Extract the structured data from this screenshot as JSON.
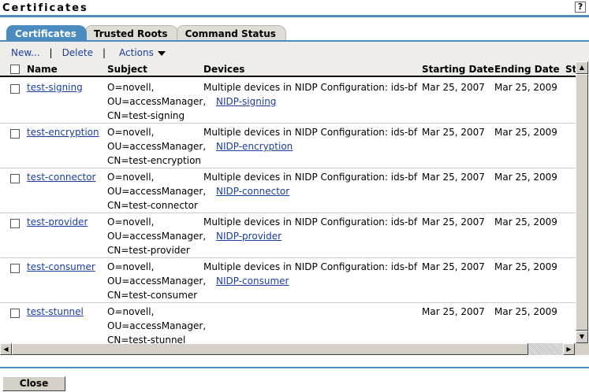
{
  "page": {
    "title": "Certificates",
    "help": "?"
  },
  "tabs": [
    {
      "label": "Certificates",
      "active": true
    },
    {
      "label": "Trusted Roots"
    },
    {
      "label": "Command Status"
    }
  ],
  "toolbar": {
    "new": "New...",
    "delete": "Delete",
    "actions": "Actions"
  },
  "columns": {
    "name": "Name",
    "subject": "Subject",
    "devices": "Devices",
    "start": "Starting Date",
    "end": "Ending Date",
    "status": "St"
  },
  "rows": [
    {
      "name": "test-signing",
      "subject": [
        "O=novell,",
        "OU=accessManager,",
        "CN=test-signing"
      ],
      "devices": "Multiple devices in NIDP Configuration: ids-bf",
      "device_link": "NIDP-signing",
      "start": "Mar 25, 2007",
      "end": "Mar 25, 2009"
    },
    {
      "name": "test-encryption",
      "subject": [
        "O=novell,",
        "OU=accessManager,",
        "CN=test-encryption"
      ],
      "devices": "Multiple devices in NIDP Configuration: ids-bf",
      "device_link": "NIDP-encryption",
      "start": "Mar 25, 2007",
      "end": "Mar 25, 2009"
    },
    {
      "name": "test-connector",
      "subject": [
        "O=novell,",
        "OU=accessManager,",
        "CN=test-connector"
      ],
      "devices": "Multiple devices in NIDP Configuration: ids-bf",
      "device_link": "NIDP-connector",
      "start": "Mar 25, 2007",
      "end": "Mar 25, 2009"
    },
    {
      "name": "test-provider",
      "subject": [
        "O=novell,",
        "OU=accessManager,",
        "CN=test-provider"
      ],
      "devices": "Multiple devices in NIDP Configuration: ids-bf",
      "device_link": "NIDP-provider",
      "start": "Mar 25, 2007",
      "end": "Mar 25, 2009"
    },
    {
      "name": "test-consumer",
      "subject": [
        "O=novell,",
        "OU=accessManager,",
        "CN=test-consumer"
      ],
      "devices": "Multiple devices in NIDP Configuration: ids-bf",
      "device_link": "NIDP-consumer",
      "start": "Mar 25, 2007",
      "end": "Mar 25, 2009"
    },
    {
      "name": "test-stunnel",
      "subject": [
        "O=novell,",
        "OU=accessManager,",
        "CN=test-stunnel"
      ],
      "devices": null,
      "device_link": null,
      "start": "Mar 25, 2007",
      "end": "Mar 25, 2009"
    }
  ],
  "footer": {
    "close": "Close"
  }
}
